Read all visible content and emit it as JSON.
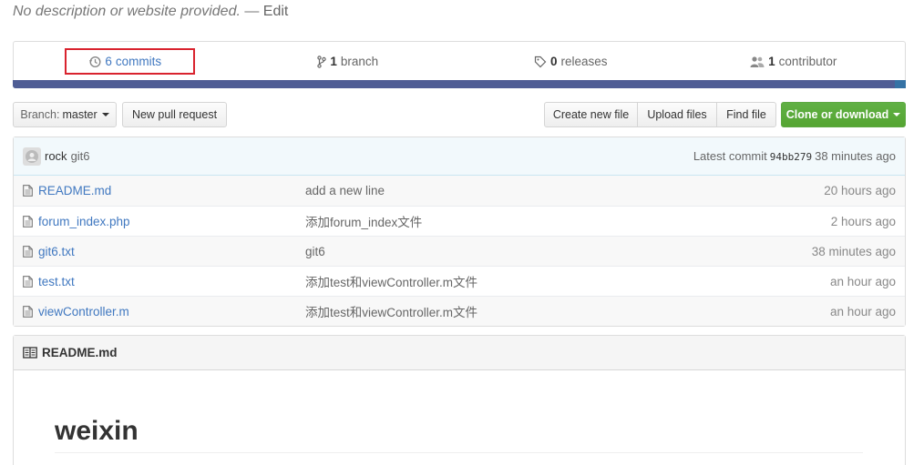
{
  "description": {
    "text": "No description or website provided.",
    "separator": " — ",
    "edit_label": "Edit"
  },
  "stats": {
    "commits_count": "6",
    "commits_label": "commits",
    "branch_count": "1",
    "branch_label": "branch",
    "releases_count": "0",
    "releases_label": "releases",
    "contributor_count": "1",
    "contributor_label": "contributor"
  },
  "toolbar": {
    "branch_prefix": "Branch:",
    "branch_value": "master",
    "new_pr_label": "New pull request",
    "create_file_label": "Create new file",
    "upload_files_label": "Upload files",
    "find_file_label": "Find file",
    "clone_label": "Clone or download"
  },
  "latest_commit": {
    "author": "rock",
    "message": "git6",
    "prefix": "Latest commit",
    "sha": "94bb279",
    "age": "38 minutes ago"
  },
  "files": [
    {
      "name": "README.md",
      "message": "add a new line",
      "age": "20 hours ago"
    },
    {
      "name": "forum_index.php",
      "message": "添加forum_index文件",
      "age": "2 hours ago"
    },
    {
      "name": "git6.txt",
      "message": "git6",
      "age": "38 minutes ago"
    },
    {
      "name": "test.txt",
      "message": "添加test和viewController.m文件",
      "age": "an hour ago"
    },
    {
      "name": "viewController.m",
      "message": "添加test和viewController.m文件",
      "age": "an hour ago"
    }
  ],
  "readme": {
    "filename": "README.md",
    "heading": "weixin"
  },
  "colors": {
    "link": "#4078c0",
    "highlight_box": "#d9232e",
    "clone_green": "#55a532",
    "lang_bar": "#4f5d95"
  },
  "icons": {
    "commits": "history-icon",
    "branch": "git-branch-icon",
    "releases": "tag-icon",
    "contributors": "people-icon",
    "file": "file-text-icon",
    "readme": "book-icon"
  }
}
